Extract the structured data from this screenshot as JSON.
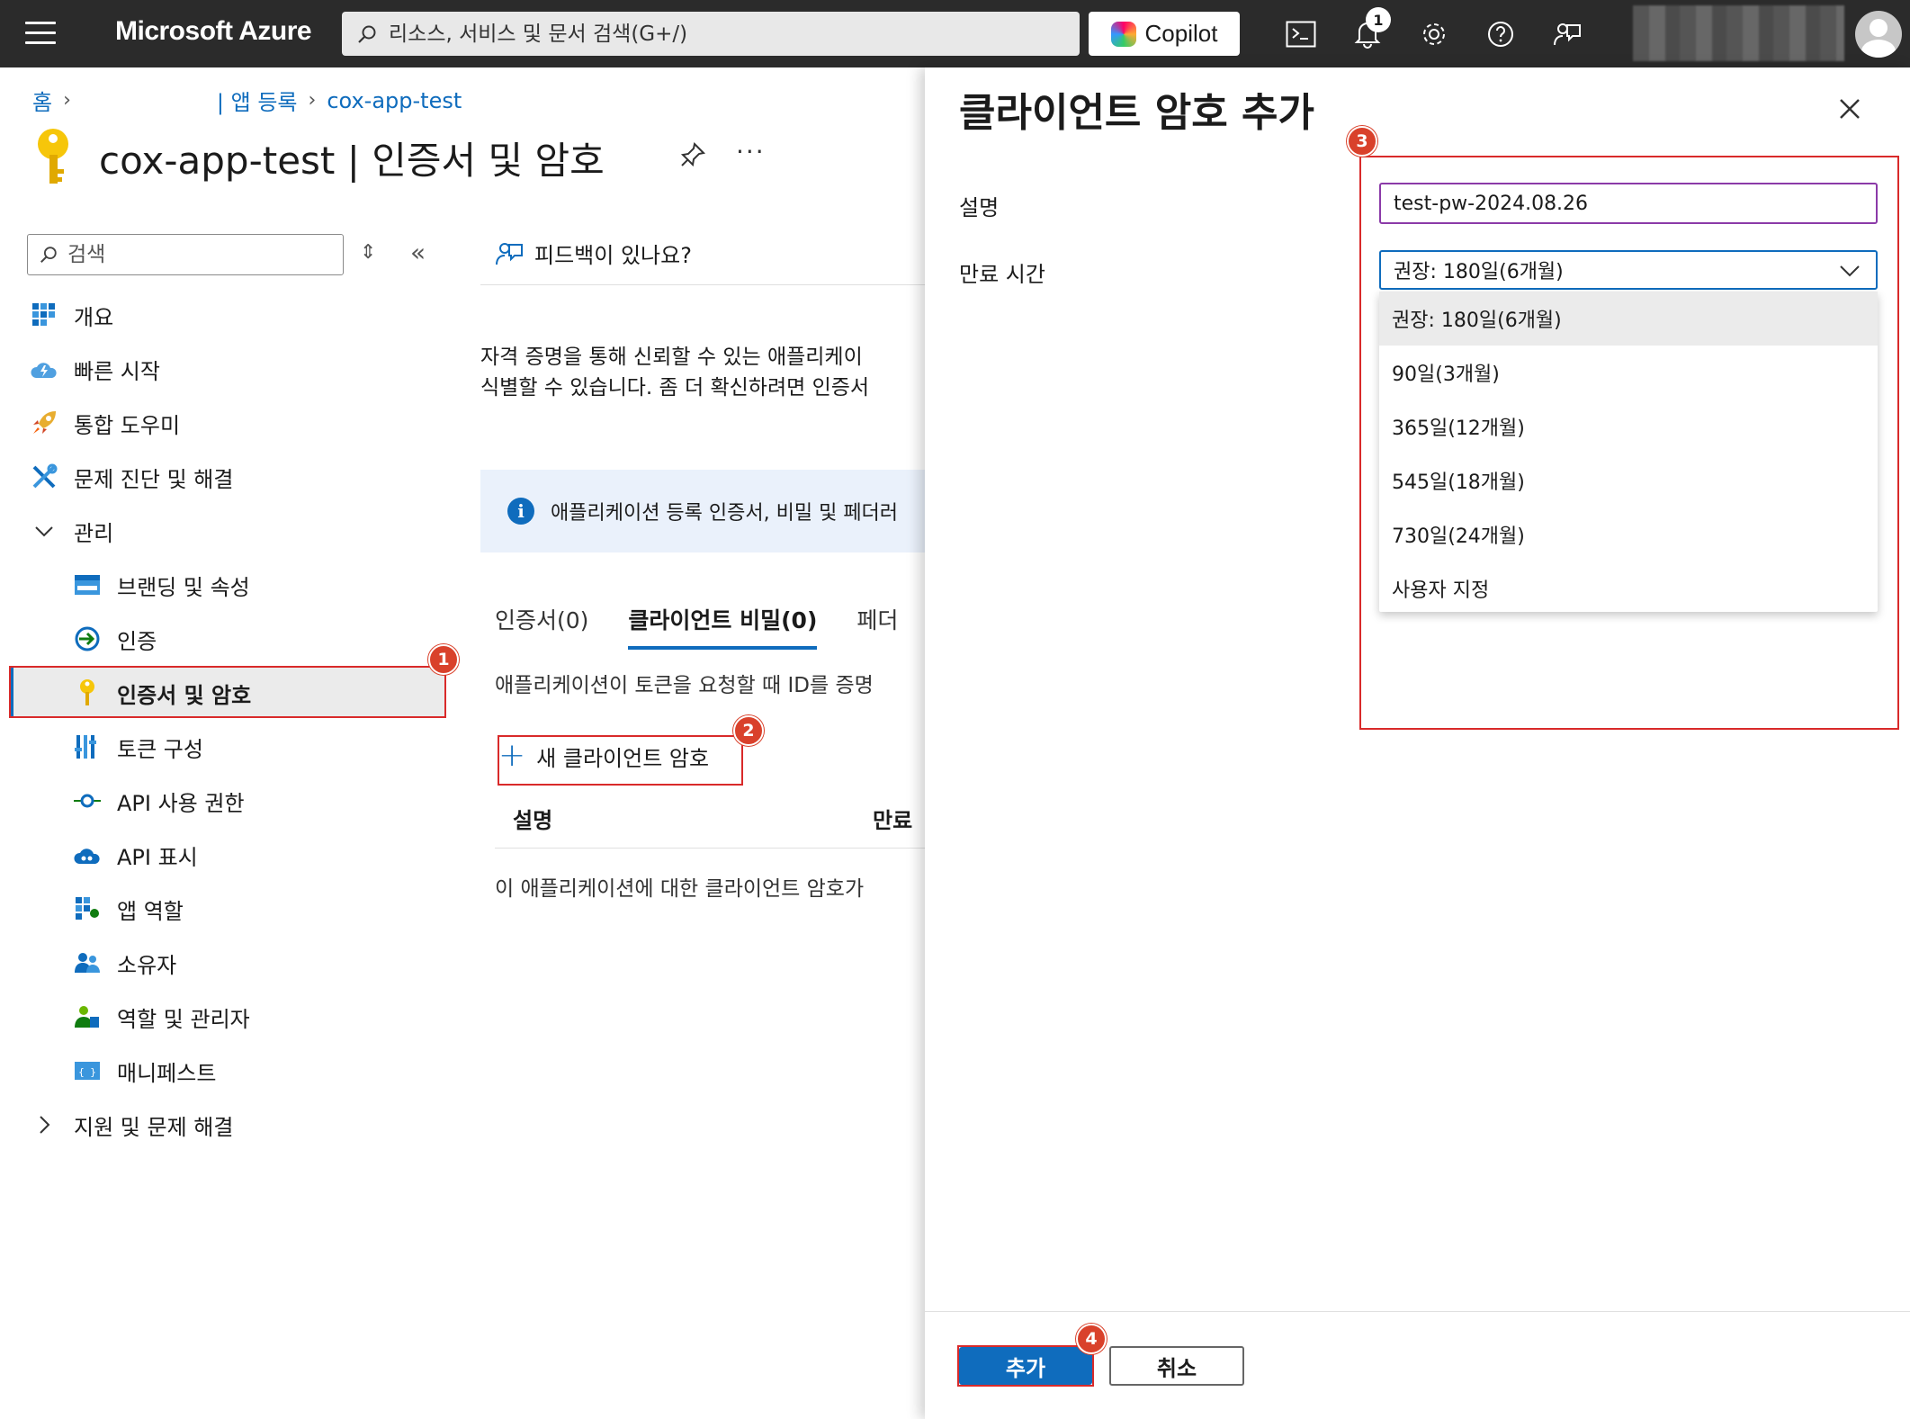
{
  "topbar": {
    "brand": "Microsoft Azure",
    "search_placeholder": "리소스, 서비스 및 문서 검색(G+/)",
    "copilot_label": "Copilot",
    "notifications_count": "1"
  },
  "breadcrumb": {
    "home": "홈",
    "app_registrations": "| 앱 등록",
    "app": "cox-app-test"
  },
  "page_title": "cox-app-test | 인증서 및 암호",
  "nav": {
    "search_placeholder": "검색",
    "items": [
      {
        "label": "개요"
      },
      {
        "label": "빠른 시작"
      },
      {
        "label": "통합 도우미"
      },
      {
        "label": "문제 진단 및 해결"
      },
      {
        "label": "관리"
      },
      {
        "label": "브랜딩 및 속성"
      },
      {
        "label": "인증"
      },
      {
        "label": "인증서 및 암호"
      },
      {
        "label": "토큰 구성"
      },
      {
        "label": "API 사용 권한"
      },
      {
        "label": "API 표시"
      },
      {
        "label": "앱 역할"
      },
      {
        "label": "소유자"
      },
      {
        "label": "역할 및 관리자"
      },
      {
        "label": "매니페스트"
      },
      {
        "label": "지원 및 문제 해결"
      }
    ]
  },
  "steps": [
    "1",
    "2",
    "3",
    "4"
  ],
  "main": {
    "feedback": "피드백이 있나요?",
    "description_line1": "자격 증명을 통해 신뢰할 수 있는 애플리케이",
    "description_line2": "식별할 수 있습니다. 좀 더 확신하려면 인증서",
    "info_text": "애플리케이션 등록 인증서, 비밀 및 페더러",
    "tabs": [
      {
        "label": "인증서(0)"
      },
      {
        "label": "클라이언트 비밀(0)"
      },
      {
        "label": "페더"
      }
    ],
    "tab_description": "애플리케이션이 토큰을 요청할 때 ID를 증명",
    "new_secret_label": "새 클라이언트 암호",
    "table_headers": [
      "설명",
      "만료"
    ],
    "empty_message": "이 애플리케이션에 대한 클라이언트 암호가"
  },
  "panel": {
    "title": "클라이언트 암호 추가",
    "description_label": "설명",
    "description_value": "test-pw-2024.08.26",
    "expiry_label": "만료 시간",
    "expiry_selected": "권장: 180일(6개월)",
    "expiry_options": [
      "권장: 180일(6개월)",
      "90일(3개월)",
      "365일(12개월)",
      "545일(18개월)",
      "730일(24개월)",
      "사용자 지정"
    ],
    "add_button": "추가",
    "cancel_button": "취소"
  }
}
